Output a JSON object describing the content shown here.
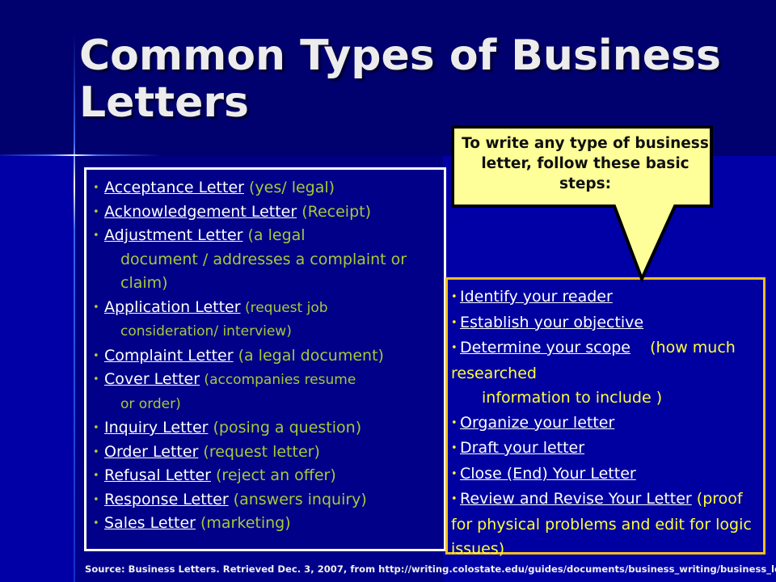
{
  "slide": {
    "title": "Common Types of Business Letters",
    "colors": {
      "background_top": "#00006e",
      "background_bottom": "#0000a6",
      "title_text": "#ececec",
      "type_desc": "#a8c838",
      "link_text": "#ffffff",
      "steps_text": "#ffff3a",
      "steps_border": "#f2be22",
      "callout_fill": "#ffff99"
    }
  },
  "letter_types": [
    {
      "name": "Acceptance Letter",
      "desc": " (yes/ legal)",
      "desc_cont": ""
    },
    {
      "name": "Acknowledgement Letter",
      "desc": " (Receipt)",
      "desc_cont": ""
    },
    {
      "name": "Adjustment Letter",
      "desc": " (a legal",
      "desc_cont": "document / addresses a complaint or claim)"
    },
    {
      "name": "Application Letter",
      "desc": " (request job",
      "desc_cont": "consideration/ interview)"
    },
    {
      "name": "Complaint Letter",
      "desc": " (a legal document)",
      "desc_cont": ""
    },
    {
      "name": "Cover Letter",
      "desc": " (accompanies resume",
      "desc_cont": "or order)"
    },
    {
      "name": "Inquiry Letter",
      "desc": " (posing a question)",
      "desc_cont": ""
    },
    {
      "name": "Order Letter",
      "desc": " (request letter)",
      "desc_cont": ""
    },
    {
      "name": "Refusal Letter",
      "desc": " (reject an offer)",
      "desc_cont": ""
    },
    {
      "name": "Response Letter",
      "desc": " (answers inquiry)",
      "desc_cont": ""
    },
    {
      "name": "Sales Letter",
      "desc": " (marketing)",
      "desc_cont": ""
    }
  ],
  "callout": {
    "text": "To write any type of business letter, follow these basic steps:"
  },
  "steps": [
    {
      "name": "Identify your reader",
      "note": "",
      "note_cont": ""
    },
    {
      "name": "Establish your objective",
      "note": "",
      "note_cont": ""
    },
    {
      "name": "Determine your scope",
      "note": "    (how much researched",
      "note_cont": "information to include )"
    },
    {
      "name": "Organize your letter",
      "note": "",
      "note_cont": ""
    },
    {
      "name": "Draft your letter",
      "note": "",
      "note_cont": ""
    },
    {
      "name": "Close (End) Your Letter",
      "note": "",
      "note_cont": ""
    },
    {
      "name": "Review and Revise Your Letter",
      "note": " (proof for physical problems and edit for logic issues)",
      "note_cont": ""
    }
  ],
  "bullet_glyph": "•",
  "source": "Source:  Business Letters.  Retrieved Dec. 3, 2007, from http://writing.colostate.edu/guides/documents/business_writing/business_letter/"
}
